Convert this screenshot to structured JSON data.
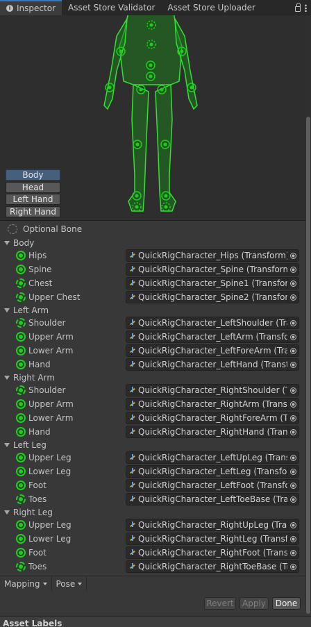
{
  "tabs": [
    {
      "label": "Inspector",
      "active": true
    },
    {
      "label": "Asset Store Validator"
    },
    {
      "label": "Asset Store Uploader"
    }
  ],
  "view_buttons": [
    "Body",
    "Head",
    "Left Hand",
    "Right Hand"
  ],
  "optional_bone_label": "Optional Bone",
  "groups": [
    {
      "label": "Body",
      "bones": [
        {
          "label": "Hips",
          "value": "QuickRigCharacter_Hips (Transform)",
          "optional": false
        },
        {
          "label": "Spine",
          "value": "QuickRigCharacter_Spine (Transform)",
          "optional": false
        },
        {
          "label": "Chest",
          "value": "QuickRigCharacter_Spine1 (Transform)",
          "optional": true
        },
        {
          "label": "Upper Chest",
          "value": "QuickRigCharacter_Spine2 (Transform)",
          "optional": true
        }
      ]
    },
    {
      "label": "Left Arm",
      "bones": [
        {
          "label": "Shoulder",
          "value": "QuickRigCharacter_LeftShoulder (Trans",
          "optional": true
        },
        {
          "label": "Upper Arm",
          "value": "QuickRigCharacter_LeftArm (Transform)",
          "optional": false
        },
        {
          "label": "Lower Arm",
          "value": "QuickRigCharacter_LeftForeArm (Tran",
          "optional": false
        },
        {
          "label": "Hand",
          "value": "QuickRigCharacter_LeftHand (Transfo",
          "optional": false
        }
      ]
    },
    {
      "label": "Right Arm",
      "bones": [
        {
          "label": "Shoulder",
          "value": "QuickRigCharacter_RightShoulder (Tra",
          "optional": true
        },
        {
          "label": "Upper Arm",
          "value": "QuickRigCharacter_RightArm (Transfo",
          "optional": false
        },
        {
          "label": "Lower Arm",
          "value": "QuickRigCharacter_RightForeArm (Tra",
          "optional": false
        },
        {
          "label": "Hand",
          "value": "QuickRigCharacter_RightHand (Transf",
          "optional": false
        }
      ]
    },
    {
      "label": "Left Leg",
      "bones": [
        {
          "label": "Upper Leg",
          "value": "QuickRigCharacter_LeftUpLeg (Transf",
          "optional": false
        },
        {
          "label": "Lower Leg",
          "value": "QuickRigCharacter_LeftLeg (Transform",
          "optional": false
        },
        {
          "label": "Foot",
          "value": "QuickRigCharacter_LeftFoot (Transform",
          "optional": false
        },
        {
          "label": "Toes",
          "value": "QuickRigCharacter_LeftToeBase (Tran",
          "optional": true
        }
      ]
    },
    {
      "label": "Right Leg",
      "bones": [
        {
          "label": "Upper Leg",
          "value": "QuickRigCharacter_RightUpLeg (Trans",
          "optional": false
        },
        {
          "label": "Lower Leg",
          "value": "QuickRigCharacter_RightLeg (Transfo",
          "optional": false
        },
        {
          "label": "Foot",
          "value": "QuickRigCharacter_RightFoot (Transfo",
          "optional": false
        },
        {
          "label": "Toes",
          "value": "QuickRigCharacter_RightToeBase (Tra",
          "optional": true
        }
      ]
    }
  ],
  "bottom": {
    "mapping": "Mapping",
    "pose": "Pose",
    "revert": "Revert",
    "apply": "Apply",
    "done": "Done"
  },
  "asset_labels": "Asset Labels",
  "colors": {
    "bone": "#17d317",
    "accent": "#3a79bb",
    "selected_button": "#46607c"
  }
}
